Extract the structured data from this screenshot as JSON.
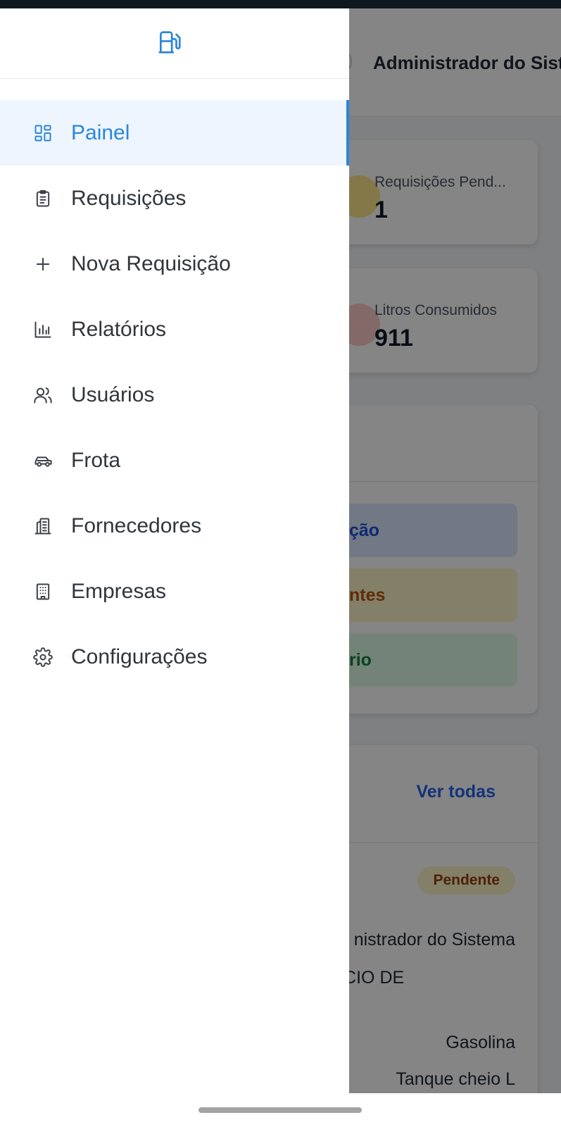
{
  "background_app": {
    "header": {
      "user_name": "Administrador do Sistema"
    },
    "stats": [
      {
        "label": "Requisições Pend...",
        "value": "1",
        "icon": "clock-icon",
        "icon_color": "#fde68a"
      },
      {
        "label": "Litros Consumidos",
        "value": "911",
        "icon": "fuel-drop-icon",
        "icon_color": "#fecaca"
      }
    ],
    "quick_actions": [
      {
        "label_fragment": "ção",
        "color": "#1e4fd8"
      },
      {
        "label_fragment": "ntes",
        "color": "#b45309"
      },
      {
        "label_fragment": "rio",
        "color": "#15803d"
      }
    ],
    "recent": {
      "see_all_label": "Ver todas",
      "status_badge": "Pendente",
      "requester_fragment": "nistrador do Sistema",
      "supplier_fragment": "RCIO DE",
      "fuel_type": "Gasolina",
      "fill_type_fragment": "Tanque cheio L"
    }
  },
  "drawer": {
    "logo_icon": "fuel-pump-icon",
    "accent_color": "#2b86d9",
    "active_item": "Painel",
    "items": [
      {
        "label": "Painel",
        "icon": "dashboard-grid-icon"
      },
      {
        "label": "Requisições",
        "icon": "clipboard-list-icon"
      },
      {
        "label": "Nova Requisição",
        "icon": "plus-icon"
      },
      {
        "label": "Relatórios",
        "icon": "bar-chart-icon"
      },
      {
        "label": "Usuários",
        "icon": "users-icon"
      },
      {
        "label": "Frota",
        "icon": "car-icon"
      },
      {
        "label": "Fornecedores",
        "icon": "building-store-icon"
      },
      {
        "label": "Empresas",
        "icon": "office-building-icon"
      },
      {
        "label": "Configurações",
        "icon": "gear-icon"
      }
    ]
  }
}
